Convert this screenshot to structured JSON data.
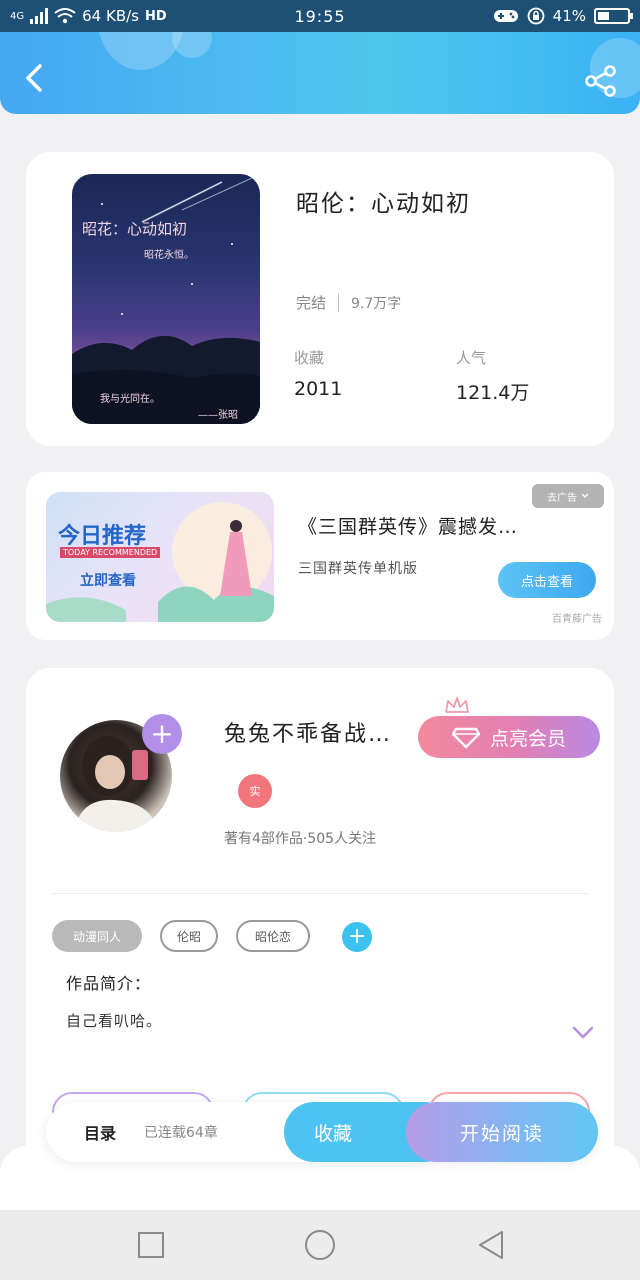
{
  "status_bar": {
    "network": "4G",
    "speed": "64 KB/s",
    "hd": "HD",
    "time": "19:55",
    "battery": "41%",
    "battery_level": 0.41
  },
  "header": {
    "back_icon": "chevron-left-icon",
    "share_icon": "share-icon"
  },
  "book": {
    "cover_lines": [
      "昭花：心动如初",
      "昭花永恒。",
      "我与光同在。",
      "——张昭"
    ],
    "title": "昭伦：心动如初",
    "status": "完结",
    "word_count": "9.7万字",
    "favorites_label": "收藏",
    "favorites_value": "2011",
    "popularity_label": "人气",
    "popularity_value": "121.4万"
  },
  "ad": {
    "banner_title": "今日推荐",
    "banner_subtitle": "TODAY RECOMMENDED",
    "banner_cta": "立即查看",
    "title": "《三国群英传》震撼发…",
    "subtitle": "三国群英传单机版",
    "button": "点击查看",
    "close_label": "去广告",
    "source": "百青藤广告"
  },
  "author": {
    "name": "兔兔不乖备战…",
    "vip_button": "点亮会员",
    "badge": "实",
    "meta": "著有4部作品·505人关注",
    "tags": [
      "动漫同人",
      "伦昭",
      "昭伦恋"
    ],
    "intro_label": "作品简介：",
    "intro_text": "自己看叭哈。"
  },
  "action_bar": {
    "toc": "目录",
    "toc_sub": "已连载64章",
    "favorite": "收藏",
    "start_reading": "开始阅读"
  },
  "colors": {
    "accent_blue": "#4cc3f0",
    "accent_purple": "#b38ee8",
    "vip_pink": "#f28a9c",
    "badge_red": "#f0767c"
  }
}
